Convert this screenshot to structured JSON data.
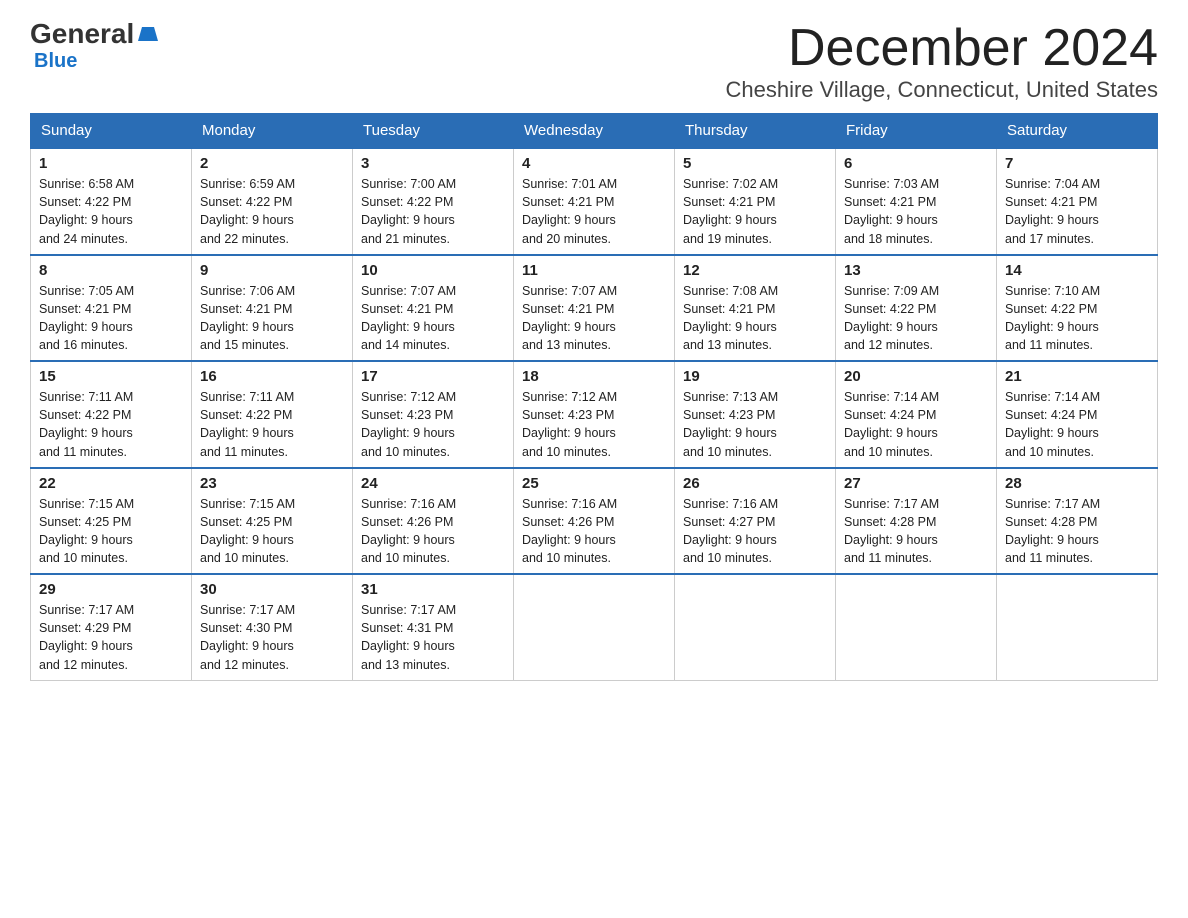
{
  "logo": {
    "general": "General",
    "blue": "Blue"
  },
  "header": {
    "month": "December 2024",
    "location": "Cheshire Village, Connecticut, United States"
  },
  "days_of_week": [
    "Sunday",
    "Monday",
    "Tuesday",
    "Wednesday",
    "Thursday",
    "Friday",
    "Saturday"
  ],
  "weeks": [
    [
      {
        "day": "1",
        "sunrise": "6:58 AM",
        "sunset": "4:22 PM",
        "daylight": "9 hours and 24 minutes."
      },
      {
        "day": "2",
        "sunrise": "6:59 AM",
        "sunset": "4:22 PM",
        "daylight": "9 hours and 22 minutes."
      },
      {
        "day": "3",
        "sunrise": "7:00 AM",
        "sunset": "4:22 PM",
        "daylight": "9 hours and 21 minutes."
      },
      {
        "day": "4",
        "sunrise": "7:01 AM",
        "sunset": "4:21 PM",
        "daylight": "9 hours and 20 minutes."
      },
      {
        "day": "5",
        "sunrise": "7:02 AM",
        "sunset": "4:21 PM",
        "daylight": "9 hours and 19 minutes."
      },
      {
        "day": "6",
        "sunrise": "7:03 AM",
        "sunset": "4:21 PM",
        "daylight": "9 hours and 18 minutes."
      },
      {
        "day": "7",
        "sunrise": "7:04 AM",
        "sunset": "4:21 PM",
        "daylight": "9 hours and 17 minutes."
      }
    ],
    [
      {
        "day": "8",
        "sunrise": "7:05 AM",
        "sunset": "4:21 PM",
        "daylight": "9 hours and 16 minutes."
      },
      {
        "day": "9",
        "sunrise": "7:06 AM",
        "sunset": "4:21 PM",
        "daylight": "9 hours and 15 minutes."
      },
      {
        "day": "10",
        "sunrise": "7:07 AM",
        "sunset": "4:21 PM",
        "daylight": "9 hours and 14 minutes."
      },
      {
        "day": "11",
        "sunrise": "7:07 AM",
        "sunset": "4:21 PM",
        "daylight": "9 hours and 13 minutes."
      },
      {
        "day": "12",
        "sunrise": "7:08 AM",
        "sunset": "4:21 PM",
        "daylight": "9 hours and 13 minutes."
      },
      {
        "day": "13",
        "sunrise": "7:09 AM",
        "sunset": "4:22 PM",
        "daylight": "9 hours and 12 minutes."
      },
      {
        "day": "14",
        "sunrise": "7:10 AM",
        "sunset": "4:22 PM",
        "daylight": "9 hours and 11 minutes."
      }
    ],
    [
      {
        "day": "15",
        "sunrise": "7:11 AM",
        "sunset": "4:22 PM",
        "daylight": "9 hours and 11 minutes."
      },
      {
        "day": "16",
        "sunrise": "7:11 AM",
        "sunset": "4:22 PM",
        "daylight": "9 hours and 11 minutes."
      },
      {
        "day": "17",
        "sunrise": "7:12 AM",
        "sunset": "4:23 PM",
        "daylight": "9 hours and 10 minutes."
      },
      {
        "day": "18",
        "sunrise": "7:12 AM",
        "sunset": "4:23 PM",
        "daylight": "9 hours and 10 minutes."
      },
      {
        "day": "19",
        "sunrise": "7:13 AM",
        "sunset": "4:23 PM",
        "daylight": "9 hours and 10 minutes."
      },
      {
        "day": "20",
        "sunrise": "7:14 AM",
        "sunset": "4:24 PM",
        "daylight": "9 hours and 10 minutes."
      },
      {
        "day": "21",
        "sunrise": "7:14 AM",
        "sunset": "4:24 PM",
        "daylight": "9 hours and 10 minutes."
      }
    ],
    [
      {
        "day": "22",
        "sunrise": "7:15 AM",
        "sunset": "4:25 PM",
        "daylight": "9 hours and 10 minutes."
      },
      {
        "day": "23",
        "sunrise": "7:15 AM",
        "sunset": "4:25 PM",
        "daylight": "9 hours and 10 minutes."
      },
      {
        "day": "24",
        "sunrise": "7:16 AM",
        "sunset": "4:26 PM",
        "daylight": "9 hours and 10 minutes."
      },
      {
        "day": "25",
        "sunrise": "7:16 AM",
        "sunset": "4:26 PM",
        "daylight": "9 hours and 10 minutes."
      },
      {
        "day": "26",
        "sunrise": "7:16 AM",
        "sunset": "4:27 PM",
        "daylight": "9 hours and 10 minutes."
      },
      {
        "day": "27",
        "sunrise": "7:17 AM",
        "sunset": "4:28 PM",
        "daylight": "9 hours and 11 minutes."
      },
      {
        "day": "28",
        "sunrise": "7:17 AM",
        "sunset": "4:28 PM",
        "daylight": "9 hours and 11 minutes."
      }
    ],
    [
      {
        "day": "29",
        "sunrise": "7:17 AM",
        "sunset": "4:29 PM",
        "daylight": "9 hours and 12 minutes."
      },
      {
        "day": "30",
        "sunrise": "7:17 AM",
        "sunset": "4:30 PM",
        "daylight": "9 hours and 12 minutes."
      },
      {
        "day": "31",
        "sunrise": "7:17 AM",
        "sunset": "4:31 PM",
        "daylight": "9 hours and 13 minutes."
      },
      null,
      null,
      null,
      null
    ]
  ]
}
